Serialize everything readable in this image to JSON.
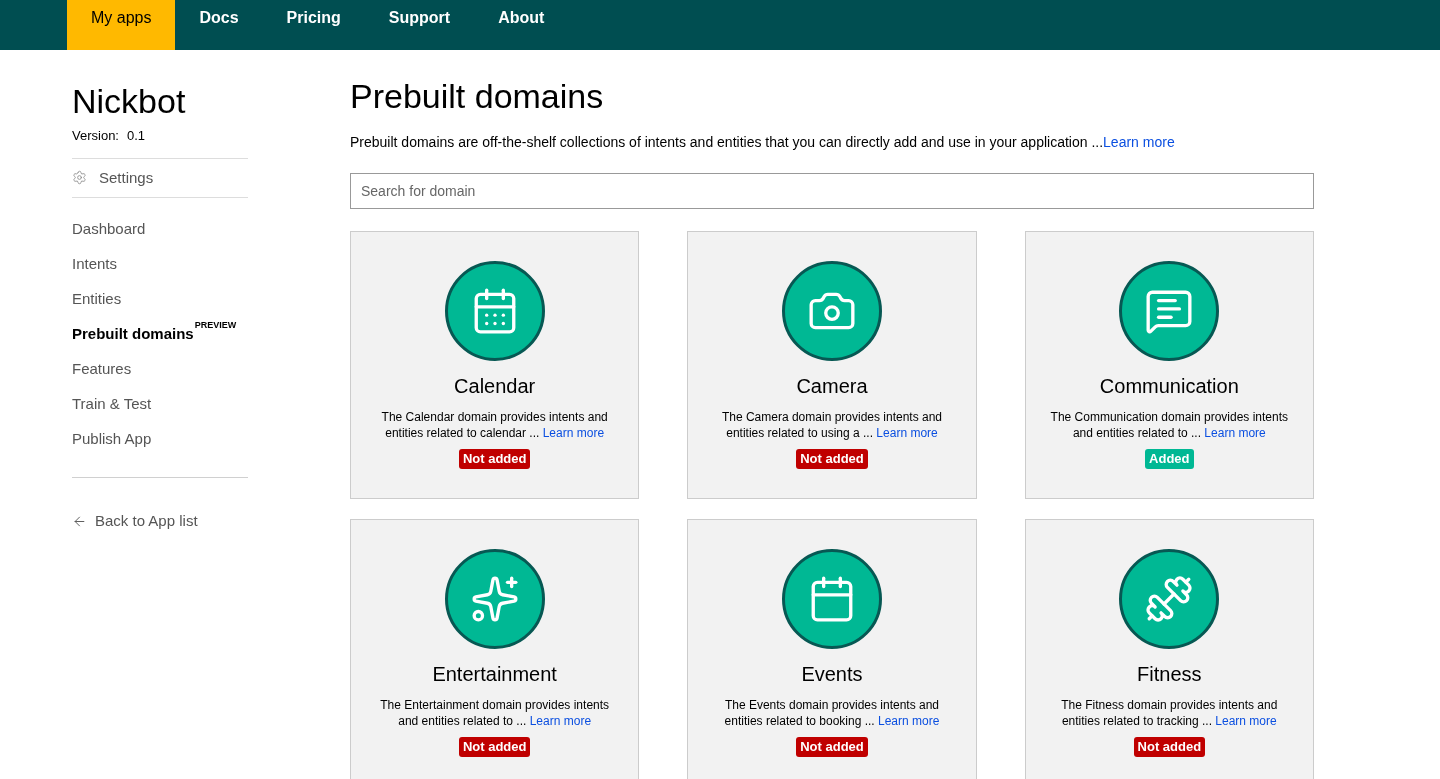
{
  "nav": [
    {
      "label": "My apps",
      "selected": true
    },
    {
      "label": "Docs",
      "selected": false
    },
    {
      "label": "Pricing",
      "selected": false
    },
    {
      "label": "Support",
      "selected": false
    },
    {
      "label": "About",
      "selected": false
    }
  ],
  "sidebar": {
    "app_name": "Nickbot",
    "version_label": "Version:",
    "version": "0.1",
    "settings": "Settings",
    "items": [
      {
        "label": "Dashboard",
        "selected": false
      },
      {
        "label": "Intents",
        "selected": false
      },
      {
        "label": "Entities",
        "selected": false
      },
      {
        "label": "Prebuilt domains",
        "selected": true,
        "badge": "PREVIEW"
      },
      {
        "label": "Features",
        "selected": false
      },
      {
        "label": "Train & Test",
        "selected": false
      },
      {
        "label": "Publish App",
        "selected": false
      }
    ],
    "back": "Back to App list"
  },
  "main": {
    "title": "Prebuilt domains",
    "intro": "Prebuilt domains are off-the-shelf collections of intents and entities that you can directly add and use in your application ...",
    "intro_link": "Learn more",
    "search": {
      "placeholder": "Search for domain"
    },
    "domains": [
      {
        "kind": "calendar",
        "name": "Calendar",
        "description": "The Calendar domain provides intents and entities related to calendar ...",
        "link": "Learn more",
        "status": "Not added",
        "added": false
      },
      {
        "kind": "camera",
        "name": "Camera",
        "description": "The Camera domain provides intents and entities related to using a ...",
        "link": "Learn more",
        "status": "Not added",
        "added": false
      },
      {
        "kind": "chat",
        "name": "Communication",
        "description": "The Communication domain provides intents and entities related to ...",
        "link": "Learn more",
        "status": "Added",
        "added": true
      },
      {
        "kind": "star",
        "name": "Entertainment",
        "description": "The Entertainment domain provides intents and entities related to ...",
        "link": "Learn more",
        "status": "Not added",
        "added": false
      },
      {
        "kind": "events",
        "name": "Events",
        "description": "The Events domain provides intents and entities related to booking ...",
        "link": "Learn more",
        "status": "Not added",
        "added": false
      },
      {
        "kind": "fitness",
        "name": "Fitness",
        "description": "The Fitness domain provides intents and entities related to tracking ...",
        "link": "Learn more",
        "status": "Not added",
        "added": false
      }
    ]
  }
}
